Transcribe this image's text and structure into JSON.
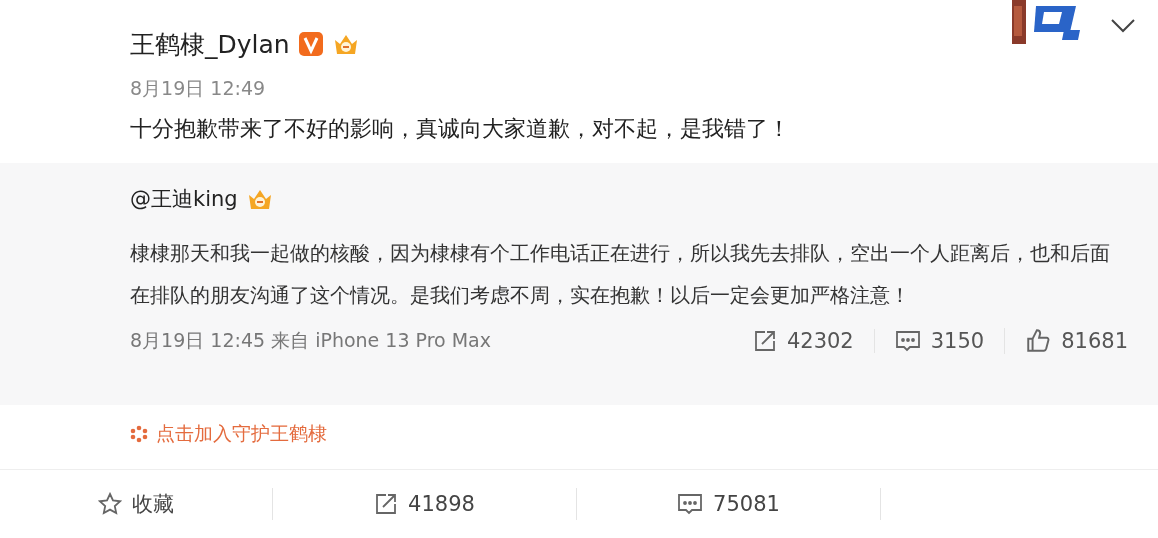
{
  "post": {
    "author": "王鹤棣_Dylan",
    "verified": true,
    "time": "8月19日 12:49",
    "text": "十分抱歉带来了不好的影响，真诚向大家道歉，对不起，是我错了！"
  },
  "repost": {
    "author": "@王迪king",
    "text": "棣棣那天和我一起做的核酸，因为棣棣有个工作电话正在进行，所以我先去排队，空出一个人距离后，也和后面在排队的朋友沟通了这个情况。是我们考虑不周，实在抱歉！以后一定会更加严格注意！",
    "time": "8月19日 12:45 来自 iPhone 13 Pro Max",
    "actions": [
      {
        "kind": "share",
        "count": "42302"
      },
      {
        "kind": "comment",
        "count": "3150"
      },
      {
        "kind": "like",
        "count": "81681"
      }
    ]
  },
  "guard_link": "点击加入守护王鹤棣",
  "bottom_bar": [
    {
      "kind": "favorite",
      "label": "收藏"
    },
    {
      "kind": "share",
      "label": "41898"
    },
    {
      "kind": "comment",
      "label": "75081"
    }
  ]
}
